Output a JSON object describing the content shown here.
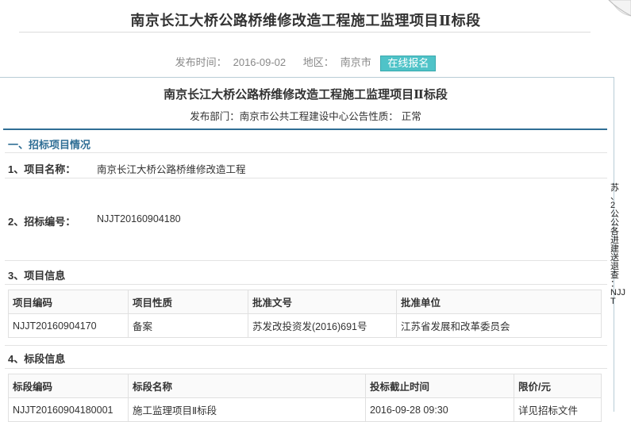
{
  "header": {
    "title": "南京长江大桥公路桥维修改造工程施工监理项目Ⅱ标段",
    "publish_label": "发布时间：",
    "publish_date": "2016-09-02",
    "region_label": "地区：",
    "region": "南京市",
    "signup_button": "在线报名"
  },
  "document": {
    "title": "南京长江大桥公路桥维修改造工程施工监理项目Ⅱ标段",
    "dept_label": "发布部门：",
    "dept_value": "南京市公共工程建设中心",
    "nature_label": "公告性质：",
    "nature_value": "正常",
    "section1_title": "一、招标项目情况",
    "project_name_label": "1、项目名称：",
    "project_name_value": "南京长江大桥公路桥维修改造工程",
    "bid_no_label": "2、招标编号：",
    "bid_no_value": "NJJT20160904180",
    "project_info_title": "3、项目信息",
    "project_table": {
      "headers": [
        "项目编码",
        "项目性质",
        "批准文号",
        "批准单位"
      ],
      "rows": [
        [
          "NJJT20160904170",
          "备案",
          "苏发改投资发(2016)691号",
          "江苏省发展和改革委员会"
        ]
      ]
    },
    "lot_info_title": "4、标段信息",
    "lot_table": {
      "headers": [
        "标段编码",
        "标段名称",
        "投标截止时间",
        "限价/元"
      ],
      "rows": [
        [
          "NJJT20160904180001",
          "施工监理项目Ⅱ标段",
          "2016-09-28 09:30",
          "详见招标文件"
        ]
      ]
    }
  },
  "side_fragment": {
    "chars": [
      "苏",
      "、",
      "2",
      "公",
      "公",
      "各",
      "进",
      "建",
      "送",
      "退",
      "查",
      "：",
      "NJJT"
    ]
  }
}
